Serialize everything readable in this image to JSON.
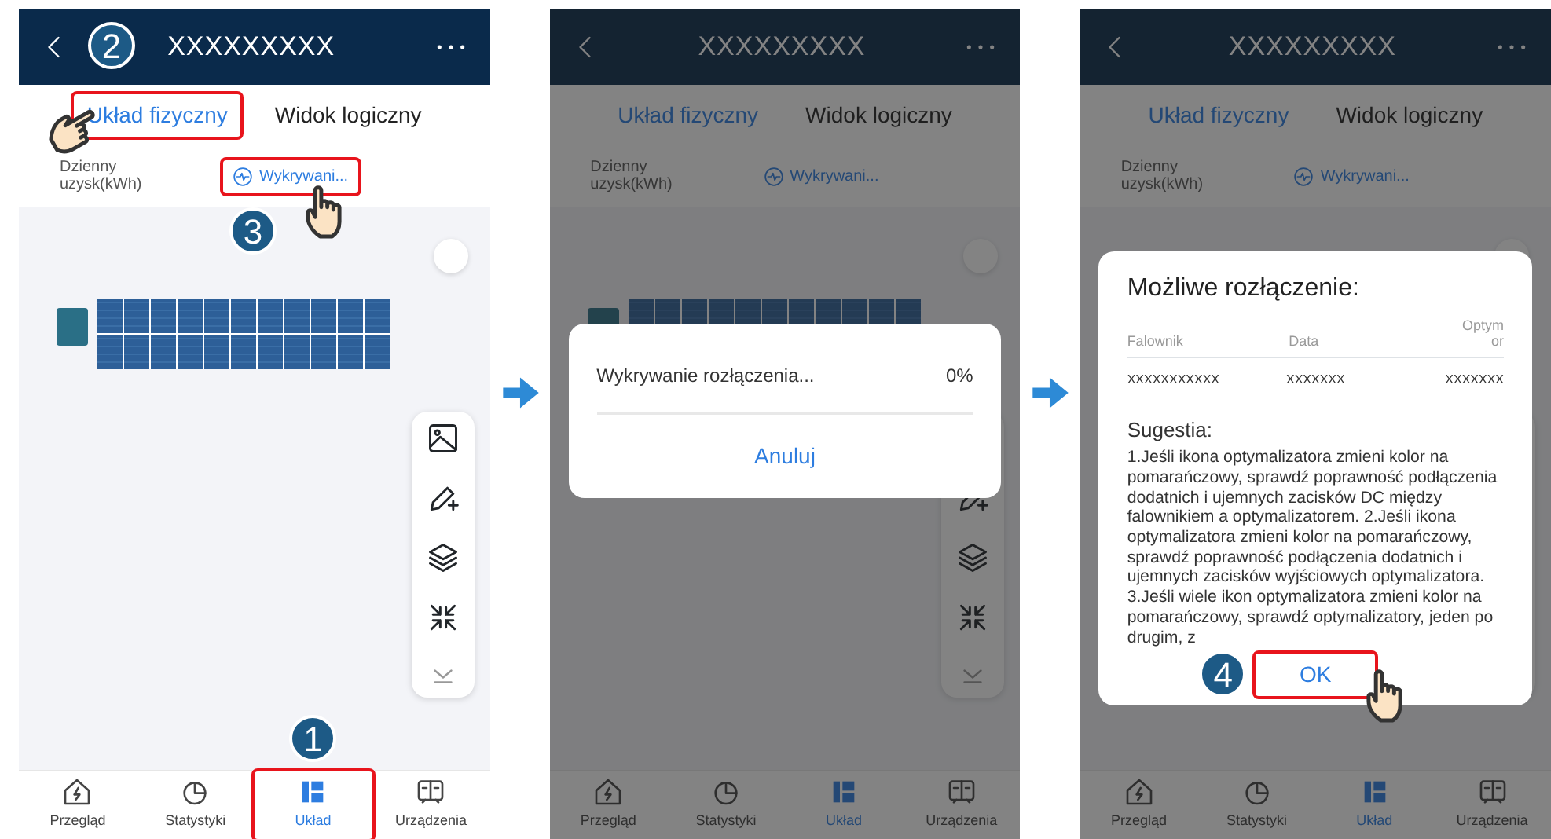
{
  "screens": [
    {
      "title": "XXXXXXXXX",
      "tabs": [
        {
          "label": "Układ fizyczny",
          "selected": true,
          "highlighted": true,
          "pointer": true,
          "step": "2"
        },
        {
          "label": "Widok logiczny",
          "selected": false,
          "highlighted": false
        }
      ],
      "yield_label": "Dzienny uzysk(kWh)",
      "detect": {
        "label": "Wykrywani...",
        "highlighted": true,
        "pointer": true,
        "step": "3"
      },
      "nav": [
        {
          "label": "Przegląd",
          "selected": false,
          "highlighted": false
        },
        {
          "label": "Statystyki",
          "selected": false,
          "highlighted": false
        },
        {
          "label": "Układ",
          "selected": true,
          "highlighted": true,
          "step": "1"
        },
        {
          "label": "Urządzenia",
          "selected": false,
          "highlighted": false
        }
      ]
    },
    {
      "title": "XXXXXXXXX",
      "tabs": [
        {
          "label": "Układ fizyczny",
          "selected": true,
          "highlighted": false,
          "pointer": false
        },
        {
          "label": "Widok logiczny",
          "selected": false,
          "highlighted": false
        }
      ],
      "yield_label": "Dzienny uzysk(kWh)",
      "detect": {
        "label": "Wykrywani...",
        "highlighted": false,
        "pointer": false
      },
      "nav": [
        {
          "label": "Przegląd",
          "selected": false,
          "highlighted": false
        },
        {
          "label": "Statystyki",
          "selected": false,
          "highlighted": false
        },
        {
          "label": "Układ",
          "selected": true,
          "highlighted": false
        },
        {
          "label": "Urządzenia",
          "selected": false,
          "highlighted": false
        }
      ],
      "dialog": {
        "kind": "progress",
        "message": "Wykrywanie rozłączenia...",
        "reading": "0%",
        "level": 0,
        "button": {
          "label": "Anuluj",
          "highlighted": false,
          "pointer": false
        }
      }
    },
    {
      "title": "XXXXXXXXX",
      "tabs": [
        {
          "label": "Układ fizyczny",
          "selected": true,
          "highlighted": false,
          "pointer": false
        },
        {
          "label": "Widok logiczny",
          "selected": false,
          "highlighted": false
        }
      ],
      "yield_label": "Dzienny uzysk(kWh)",
      "detect": {
        "label": "Wykrywani...",
        "highlighted": false,
        "pointer": false
      },
      "nav": [
        {
          "label": "Przegląd",
          "selected": false,
          "highlighted": false
        },
        {
          "label": "Statystyki",
          "selected": false,
          "highlighted": false
        },
        {
          "label": "Układ",
          "selected": true,
          "highlighted": false
        },
        {
          "label": "Urządzenia",
          "selected": false,
          "highlighted": false
        }
      ],
      "dialog": {
        "kind": "result",
        "title": "Możliwe rozłączenie:",
        "columns": [
          "Falownik",
          "Data",
          "Optym or"
        ],
        "rows": [
          [
            "XXXXXXXXXXX",
            "XXXXXXX",
            "XXXXXXX"
          ]
        ],
        "subtitle": "Sugestia:",
        "text": "1.Jeśli ikona optymalizatora zmieni kolor na pomarańczowy, sprawdź poprawność podłączenia dodatnich i ujemnych zacisków DC między falownikiem a optymalizatorem. 2.Jeśli ikona optymalizatora zmieni kolor na pomarańczowy, sprawdź poprawność podłączenia dodatnich i ujemnych zacisków wyjściowych optymalizatora. 3.Jeśli wiele ikon optymalizatora zmieni kolor na pomarańczowy, sprawdź optymalizatory, jeden po drugim, z",
        "button": {
          "label": "OK",
          "highlighted": true,
          "pointer": true,
          "step": "4"
        }
      }
    }
  ]
}
